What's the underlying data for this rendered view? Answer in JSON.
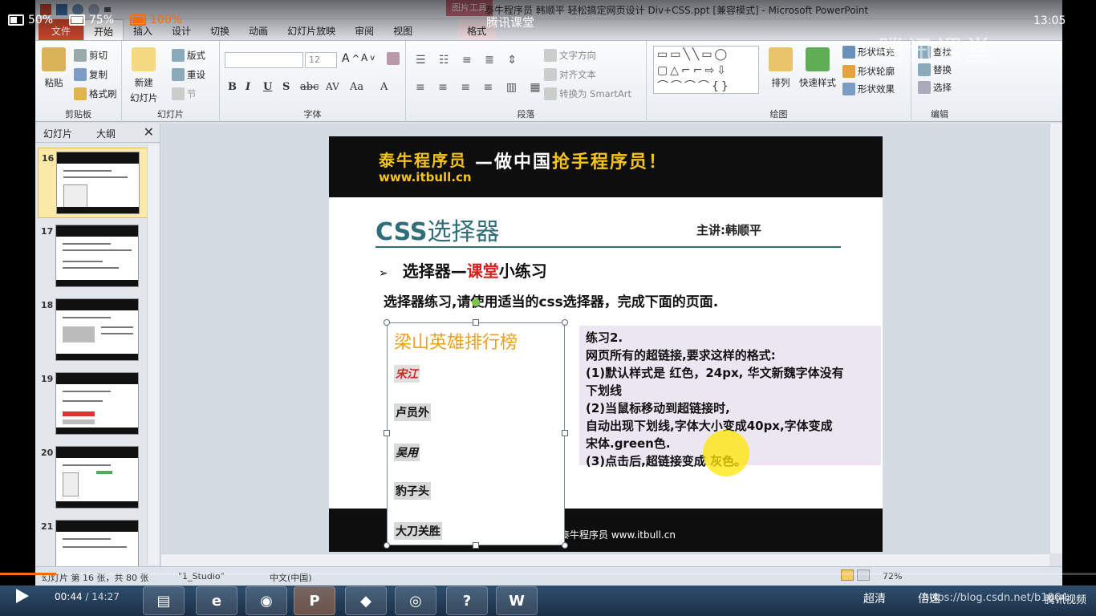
{
  "overlay": {
    "speed_50": "50%",
    "speed_75": "75%",
    "speed_100": "100%",
    "channel": "腾讯课堂",
    "clock": "13:05",
    "watermark": "腾讯课堂"
  },
  "window": {
    "title": "泰牛程序员 韩顺平 轻松搞定网页设计 Div+CSS.ppt [兼容模式] - Microsoft PowerPoint",
    "tool_tab": "图片工具"
  },
  "ribbon_tabs": [
    "文件",
    "开始",
    "插入",
    "设计",
    "切换",
    "动画",
    "幻灯片放映",
    "审阅",
    "视图",
    "格式"
  ],
  "ribbon": {
    "clipboard": {
      "paste": "粘贴",
      "cut": "剪切",
      "copy": "复制",
      "format_painter": "格式刷",
      "label": "剪贴板"
    },
    "slides": {
      "new_slide": "新建",
      "new_slide_2": "幻灯片",
      "layout": "版式",
      "reset": "重设",
      "section": "节",
      "label": "幻灯片"
    },
    "font": {
      "size": "12",
      "label": "字体",
      "bold": "B",
      "italic": "I",
      "underline": "U",
      "strike": "S",
      "abc": "abc",
      "spacing": "AV",
      "case": "Aa",
      "color": "A"
    },
    "paragraph": {
      "text_direction": "文字方向",
      "align_text": "对齐文本",
      "smartart": "转换为 SmartArt",
      "label": "段落"
    },
    "drawing": {
      "arrange": "排列",
      "quick_styles": "快速样式",
      "fill": "形状填充",
      "outline": "形状轮廓",
      "effects": "形状效果",
      "label": "绘图"
    },
    "editing": {
      "find": "查找",
      "replace": "替换",
      "select": "选择",
      "label": "编辑"
    }
  },
  "panel": {
    "tab_slides": "幻灯片",
    "tab_outline": "大纲",
    "thumbnails": [
      "16",
      "17",
      "18",
      "19",
      "20",
      "21"
    ]
  },
  "slide": {
    "brand": "泰牛程序员",
    "slogan_prefix": "—做中国",
    "slogan_highlight": "抢手程序员！",
    "url": "www.itbull.cn",
    "title_css": "CSS",
    "title_rest": "选择器",
    "lecturer": "主讲:韩顺平",
    "bullet_arrow": "➢",
    "bullet_a": "选择器—",
    "bullet_red": "课堂",
    "bullet_b": "小练习",
    "intro": "选择器练习,请使用适当的css选择器，完成下面的页面.",
    "picture": {
      "title": "梁山英雄排行榜",
      "items": [
        "宋江",
        "卢员外",
        "吴用",
        "豹子头",
        "大刀关胜"
      ]
    },
    "note_lines": [
      "练习2.",
      "网页所有的超链接,要求这样的格式:",
      "(1)默认样式是 红色，24px, 华文新魏字体没有",
      "下划线",
      "(2)当鼠标移动到超链接时,",
      "自动出现下划线,字体大小变成40px,字体变成",
      "宋体.green色.",
      "(3)点击后,超链接变成 灰色。"
    ],
    "footer": "泰牛程序员  www.itbull.cn"
  },
  "status": {
    "slide_info": "幻灯片 第 16 张，共 80 张",
    "theme": "\"1_Studio\"",
    "language": "中文(中国)",
    "zoom": "72%"
  },
  "player": {
    "current_time": "00:44",
    "total_time": "14:27",
    "progress_fraction": 0.051,
    "quality": "超清",
    "speed": "倍速",
    "url": "https://blog.csdn.net/b1064",
    "brand": "腾讯视频"
  },
  "colors": {
    "brand_yellow": "#f4c418",
    "title_teal": "#2e6e78",
    "red_accent": "#d61f1f",
    "progress_orange": "#ff6a00"
  }
}
